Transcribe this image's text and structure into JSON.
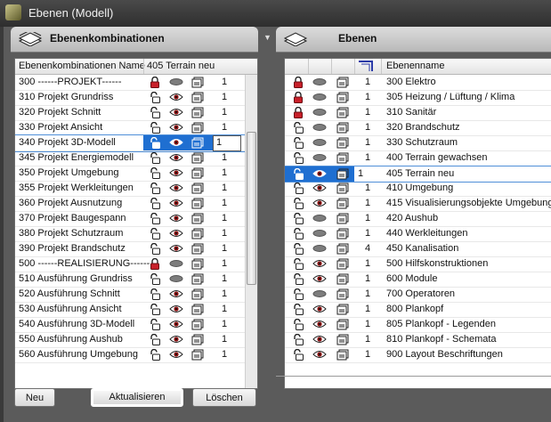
{
  "window": {
    "title": "Ebenen (Modell)"
  },
  "left_panel": {
    "title": "Ebenenkombinationen",
    "col_name": "Ebenenkombinationen Name",
    "col_current": "405 Terrain neu",
    "rows": [
      {
        "label": "300 ------PROJEKT------",
        "lock": "red",
        "vis": "hidden",
        "num": "1"
      },
      {
        "label": "310 Projekt Grundriss",
        "lock": "open",
        "vis": "eye",
        "num": "1"
      },
      {
        "label": "320 Projekt Schnitt",
        "lock": "open",
        "vis": "eye",
        "num": "1"
      },
      {
        "label": "330 Projekt Ansicht",
        "lock": "open",
        "vis": "eye",
        "num": "1"
      },
      {
        "label": "340 Projekt 3D-Modell",
        "lock": "open",
        "vis": "eye",
        "num": "1"
      },
      {
        "label": "345 Projekt Energiemodell",
        "lock": "open",
        "vis": "eye",
        "num": "1"
      },
      {
        "label": "350 Projekt Umgebung",
        "lock": "open",
        "vis": "eye",
        "num": "1"
      },
      {
        "label": "355 Projekt Werkleitungen",
        "lock": "open",
        "vis": "eye",
        "num": "1"
      },
      {
        "label": "360 Projekt Ausnutzung",
        "lock": "open",
        "vis": "eye",
        "num": "1"
      },
      {
        "label": "370 Projekt Baugespann",
        "lock": "open",
        "vis": "eye",
        "num": "1"
      },
      {
        "label": "380 Projekt Schutzraum",
        "lock": "open",
        "vis": "eye",
        "num": "1"
      },
      {
        "label": "390 Projekt Brandschutz",
        "lock": "open",
        "vis": "eye",
        "num": "1"
      },
      {
        "label": "500 ------REALISIERUNG------",
        "lock": "red",
        "vis": "hidden",
        "num": "1"
      },
      {
        "label": "510 Ausführung Grundriss",
        "lock": "open",
        "vis": "hidden",
        "num": "1"
      },
      {
        "label": "520 Ausführung Schnitt",
        "lock": "open",
        "vis": "eye",
        "num": "1"
      },
      {
        "label": "530 Ausführung Ansicht",
        "lock": "open",
        "vis": "eye",
        "num": "1"
      },
      {
        "label": "540 Ausführung 3D-Modell",
        "lock": "open",
        "vis": "eye",
        "num": "1"
      },
      {
        "label": "550 Ausführung Aushub",
        "lock": "open",
        "vis": "eye",
        "num": "1"
      },
      {
        "label": "560 Ausführung Umgebung",
        "lock": "open",
        "vis": "eye",
        "num": "1"
      }
    ]
  },
  "right_panel": {
    "title": "Ebenen",
    "col_name": "Ebenenname",
    "rows": [
      {
        "label": "300 Elektro",
        "lock": "red",
        "vis": "hidden",
        "num": "1"
      },
      {
        "label": "305 Heizung / Lüftung / Klima",
        "lock": "red",
        "vis": "hidden",
        "num": "1"
      },
      {
        "label": "310 Sanitär",
        "lock": "red",
        "vis": "hidden",
        "num": "1"
      },
      {
        "label": "320 Brandschutz",
        "lock": "open",
        "vis": "hidden",
        "num": "1"
      },
      {
        "label": "330 Schutzraum",
        "lock": "open",
        "vis": "hidden",
        "num": "1"
      },
      {
        "label": "400 Terrain gewachsen",
        "lock": "open",
        "vis": "hidden",
        "num": "1"
      },
      {
        "label": "405 Terrain neu",
        "lock": "open",
        "vis": "eye",
        "num": "1"
      },
      {
        "label": "410 Umgebung",
        "lock": "open",
        "vis": "eye",
        "num": "1"
      },
      {
        "label": "415 Visualisierungsobjekte Umgebung",
        "lock": "open",
        "vis": "eye",
        "num": "1"
      },
      {
        "label": "420 Aushub",
        "lock": "open",
        "vis": "hidden",
        "num": "1"
      },
      {
        "label": "440 Werkleitungen",
        "lock": "open",
        "vis": "hidden",
        "num": "1"
      },
      {
        "label": "450 Kanalisation",
        "lock": "open",
        "vis": "hidden",
        "num": "4"
      },
      {
        "label": "500 Hilfskonstruktionen",
        "lock": "open",
        "vis": "eye",
        "num": "1"
      },
      {
        "label": "600 Module",
        "lock": "open",
        "vis": "eye",
        "num": "1"
      },
      {
        "label": "700 Operatoren",
        "lock": "open",
        "vis": "hidden",
        "num": "1"
      },
      {
        "label": "800 Plankopf",
        "lock": "open",
        "vis": "eye",
        "num": "1"
      },
      {
        "label": "805 Plankopf - Legenden",
        "lock": "open",
        "vis": "eye",
        "num": "1"
      },
      {
        "label": "810 Plankopf - Schemata",
        "lock": "open",
        "vis": "eye",
        "num": "1"
      },
      {
        "label": "900 Layout Beschriftungen",
        "lock": "open",
        "vis": "eye",
        "num": "1"
      }
    ]
  },
  "buttons": {
    "new": "Neu",
    "update": "Aktualisieren",
    "delete": "Löschen"
  },
  "colors": {
    "selection": "#1f6fd1",
    "lock_red": "#c8202a",
    "panel_bg": "#5b5b5b"
  }
}
